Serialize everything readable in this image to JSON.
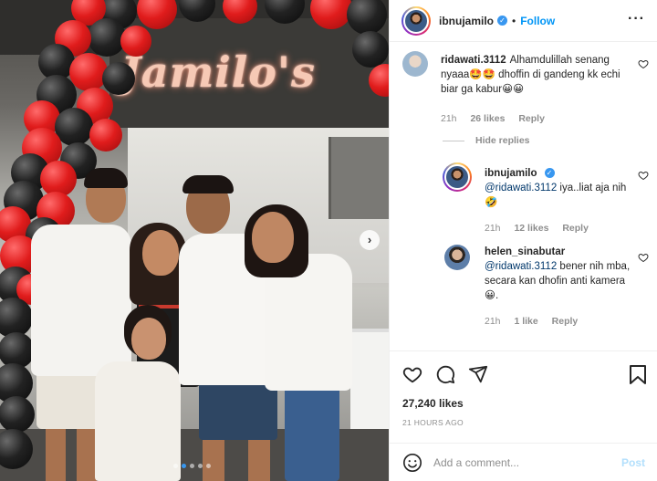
{
  "header": {
    "username": "ibnujamilo",
    "separator": "•",
    "follow_label": "Follow",
    "more_icon": "more-horizontal-icon"
  },
  "photo": {
    "sign_text": "Jamilo's",
    "carousel_count": 5,
    "carousel_active_index": 1
  },
  "comments": [
    {
      "username": "ridawati.3112",
      "text": "Alhamdulillah senang nyaaa🤩🤩 dhoffin di gandeng kk echi biar ga kabur😀😀",
      "time": "21h",
      "likes": "26 likes",
      "reply_label": "Reply"
    }
  ],
  "replies_toggle": "Hide replies",
  "replies": [
    {
      "username": "ibnujamilo",
      "mention": "@ridawati.3112",
      "text": " iya..liat aja nih 🤣",
      "time": "21h",
      "likes": "12 likes",
      "reply_label": "Reply"
    },
    {
      "username": "helen_sinabutar",
      "mention": "@ridawati.3112",
      "text": " bener nih mba, secara kan dhofin anti kamera😀.",
      "time": "21h",
      "likes": "1 like",
      "reply_label": "Reply"
    }
  ],
  "actions": {
    "likes_count": "27,240 likes",
    "timestamp": "21 HOURS AGO"
  },
  "add_comment": {
    "placeholder": "Add a comment...",
    "post_label": "Post"
  },
  "colors": {
    "accent": "#0095f6",
    "verified": "#3897f0",
    "balloon_red": "#e01c1c",
    "balloon_black": "#1a1a1a"
  }
}
